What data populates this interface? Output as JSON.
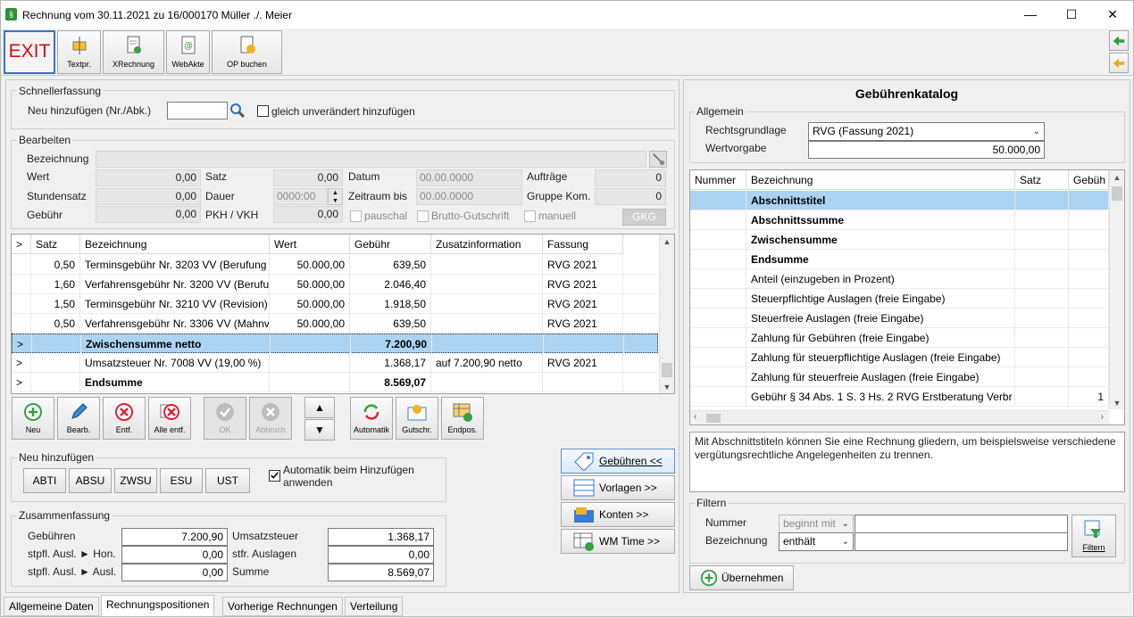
{
  "window": {
    "title": "Rechnung vom 30.11.2021 zu 16/000170  Müller ./. Meier"
  },
  "toolbar": {
    "exit": "EXIT",
    "textpr": "Textpr.",
    "xrechnung": "XRechnung",
    "webakte": "WebAkte",
    "op_buchen": "OP buchen"
  },
  "schnell": {
    "group": "Schnellerfassung",
    "neu_label": "Neu hinzufügen (Nr./Abk.)",
    "neu_value": "",
    "gleich_label": "gleich unverändert hinzufügen"
  },
  "bearbeiten": {
    "group": "Bearbeiten",
    "bezeichnung_label": "Bezeichnung",
    "bezeichnung_value": "",
    "wert_label": "Wert",
    "wert_value": "0,00",
    "stundensatz_label": "Stundensatz",
    "stundensatz_value": "0,00",
    "gebuehr_label": "Gebühr",
    "gebuehr_value": "0,00",
    "satz_label": "Satz",
    "satz_value": "0,00",
    "dauer_label": "Dauer",
    "dauer_value": "0000:00",
    "pkh_label": "PKH / VKH",
    "pkh_value": "0,00",
    "datum_label": "Datum",
    "datum_value": "00.00.0000",
    "zeitraum_label": "Zeitraum bis",
    "zeitraum_value": "00.00.0000",
    "auftraege_label": "Aufträge",
    "auftraege_value": "0",
    "gruppe_label": "Gruppe Kom.",
    "gruppe_value": "0",
    "pauschal_label": "pauschal",
    "brutto_label": "Brutto-Gutschrift",
    "manuell_label": "manuell",
    "gkg_label": "GKG"
  },
  "positions": {
    "headers": [
      ">",
      "Satz",
      "Bezeichnung",
      "Wert",
      "Gebühr",
      "Zusatzinformation",
      "Fassung"
    ],
    "rows": [
      {
        "m": "",
        "satz": "0,50",
        "bez": "Terminsgebühr Nr. 3203 VV (Berufung",
        "wert": "50.000,00",
        "geb": "639,50",
        "zus": "",
        "fas": "RVG 2021",
        "style": ""
      },
      {
        "m": "",
        "satz": "1,60",
        "bez": "Verfahrensgebühr Nr. 3200 VV (Berufu",
        "wert": "50.000,00",
        "geb": "2.046,40",
        "zus": "",
        "fas": "RVG 2021",
        "style": ""
      },
      {
        "m": "",
        "satz": "1,50",
        "bez": "Terminsgebühr Nr. 3210 VV (Revision)",
        "wert": "50.000,00",
        "geb": "1.918,50",
        "zus": "",
        "fas": "RVG 2021",
        "style": ""
      },
      {
        "m": "",
        "satz": "0,50",
        "bez": "Verfahrensgebühr Nr. 3306 VV (Mahnv",
        "wert": "50.000,00",
        "geb": "639,50",
        "zus": "",
        "fas": "RVG 2021",
        "style": ""
      },
      {
        "m": ">",
        "satz": "",
        "bez": "Zwischensumme netto",
        "wert": "",
        "geb": "7.200,90",
        "zus": "",
        "fas": "",
        "style": "sel"
      },
      {
        "m": ">",
        "satz": "",
        "bez": "Umsatzsteuer Nr. 7008 VV (19,00 %)",
        "wert": "",
        "geb": "1.368,17",
        "zus": "auf 7.200,90 netto",
        "fas": "RVG 2021",
        "style": ""
      },
      {
        "m": ">",
        "satz": "",
        "bez": "Endsumme",
        "wert": "",
        "geb": "8.569,07",
        "zus": "",
        "fas": "",
        "style": "bold"
      }
    ]
  },
  "actions": {
    "neu": "Neu",
    "bearb": "Bearb.",
    "entf": "Entf.",
    "alle_entf": "Alle entf.",
    "ok": "OK",
    "abbruch": "Abbruch",
    "automatik": "Automatik",
    "gutschr": "Gutschr.",
    "endpos": "Endpos."
  },
  "neuhinz": {
    "group": "Neu hinzufügen",
    "buttons": [
      "ABTI",
      "ABSU",
      "ZWSU",
      "ESU",
      "UST"
    ],
    "auto_label": "Automatik beim Hinzufügen anwenden",
    "auto_checked": true
  },
  "side_buttons": {
    "gebuehren": "Gebühren <<",
    "vorlagen": "Vorlagen >>",
    "konten": "Konten >>",
    "wmtime": "WM Time >>"
  },
  "zusammen": {
    "group": "Zusammenfassung",
    "gebuehren_label": "Gebühren",
    "gebuehren_value": "7.200,90",
    "hon_label": "stpfl. Ausl. ► Hon.",
    "hon_value": "0,00",
    "ausl_label": "stpfl. Ausl. ► Ausl.",
    "ausl_value": "0,00",
    "ust_label": "Umsatzsteuer",
    "ust_value": "1.368,17",
    "stfr_label": "stfr. Auslagen",
    "stfr_value": "0,00",
    "summe_label": "Summe",
    "summe_value": "8.569,07"
  },
  "katalog": {
    "title": "Gebührenkatalog",
    "allgemein": "Allgemein",
    "rechtsgrundlage_label": "Rechtsgrundlage",
    "rechtsgrundlage_value": "RVG (Fassung 2021)",
    "wertvorgabe_label": "Wertvorgabe",
    "wertvorgabe_value": "50.000,00",
    "headers": [
      "Nummer",
      "Bezeichnung",
      "Satz",
      "Gebüh"
    ],
    "rows": [
      {
        "num": "",
        "bez": "Abschnittstitel",
        "satz": "",
        "geb": "",
        "style": "selbold"
      },
      {
        "num": "",
        "bez": "Abschnittssumme",
        "satz": "",
        "geb": "",
        "style": "bold"
      },
      {
        "num": "",
        "bez": "Zwischensumme",
        "satz": "",
        "geb": "",
        "style": "bold"
      },
      {
        "num": "",
        "bez": "Endsumme",
        "satz": "",
        "geb": "",
        "style": "bold"
      },
      {
        "num": "",
        "bez": "Anteil (einzugeben in Prozent)",
        "satz": "",
        "geb": "",
        "style": ""
      },
      {
        "num": "",
        "bez": "Steuerpflichtige Auslagen (freie Eingabe)",
        "satz": "",
        "geb": "",
        "style": ""
      },
      {
        "num": "",
        "bez": "Steuerfreie Auslagen (freie Eingabe)",
        "satz": "",
        "geb": "",
        "style": ""
      },
      {
        "num": "",
        "bez": "Zahlung für Gebühren (freie Eingabe)",
        "satz": "",
        "geb": "",
        "style": ""
      },
      {
        "num": "",
        "bez": "Zahlung für steuerpflichtige Auslagen (freie Eingabe)",
        "satz": "",
        "geb": "",
        "style": ""
      },
      {
        "num": "",
        "bez": "Zahlung für steuerfreie Auslagen (freie Eingabe)",
        "satz": "",
        "geb": "",
        "style": ""
      },
      {
        "num": "",
        "bez": "Gebühr § 34 Abs. 1 S. 3 Hs. 2 RVG Erstberatung Verbr",
        "satz": "",
        "geb": "1",
        "style": ""
      }
    ],
    "description": "Mit Abschnittstiteln können Sie eine Rechnung gliedern, um beispielsweise verschiedene vergütungsrechtliche Angelegenheiten zu trennen.",
    "filtern": "Filtern",
    "nummer_label": "Nummer",
    "nummer_mode": "beginnt mit",
    "bez_label": "Bezeichnung",
    "bez_mode": "enthält",
    "filtern_btn": "Filtern",
    "uebernehmen": "Übernehmen"
  },
  "tabs": [
    "Allgemeine Daten",
    "Rechnungspositionen",
    "Vorherige Rechnungen",
    "Verteilung"
  ]
}
